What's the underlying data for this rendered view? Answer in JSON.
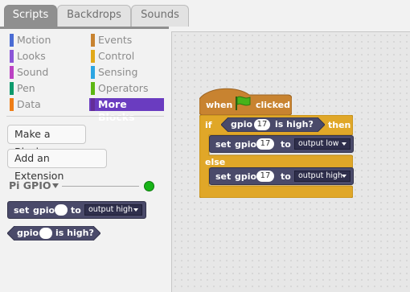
{
  "tabs": [
    {
      "label": "Scripts",
      "active": true
    },
    {
      "label": "Backdrops",
      "active": false
    },
    {
      "label": "Sounds",
      "active": false
    }
  ],
  "categories": {
    "left": [
      {
        "label": "Motion",
        "color": "#4a6cd4"
      },
      {
        "label": "Looks",
        "color": "#8a55d7"
      },
      {
        "label": "Sound",
        "color": "#bb42c3"
      },
      {
        "label": "Pen",
        "color": "#0e9a6c"
      },
      {
        "label": "Data",
        "color": "#ee7d16"
      }
    ],
    "right": [
      {
        "label": "Events",
        "color": "#c88330"
      },
      {
        "label": "Control",
        "color": "#e1a91a"
      },
      {
        "label": "Sensing",
        "color": "#2ca5e2"
      },
      {
        "label": "Operators",
        "color": "#5cb712"
      },
      {
        "label": "More Blocks",
        "color": "#632d99",
        "selected": true
      }
    ]
  },
  "buttons": {
    "make_block": "Make a Block",
    "add_extension": "Add an Extension"
  },
  "extension": {
    "title": "Pi GPIO",
    "status_color": "#18b418"
  },
  "palette_blocks": {
    "set_gpio": {
      "set": "set",
      "gpio": "gpio",
      "to": "to",
      "dropdown": "output high"
    },
    "gpio_high": {
      "gpio": "gpio",
      "is_high": "is high?"
    }
  },
  "script": {
    "hat": {
      "when": "when",
      "clicked": "clicked"
    },
    "if_block": {
      "if": "if",
      "then": "then",
      "else": "else"
    },
    "condition": {
      "gpio": "gpio",
      "pin": "17",
      "is_high": "is high?"
    },
    "set_low": {
      "set": "set",
      "gpio": "gpio",
      "pin": "17",
      "to": "to",
      "dropdown": "output low"
    },
    "set_high": {
      "set": "set",
      "gpio": "gpio",
      "pin": "17",
      "to": "to",
      "dropdown": "output high"
    }
  },
  "colors": {
    "events": "#c88330",
    "control": "#e0a728",
    "extension_block": "#4a4a6a"
  }
}
